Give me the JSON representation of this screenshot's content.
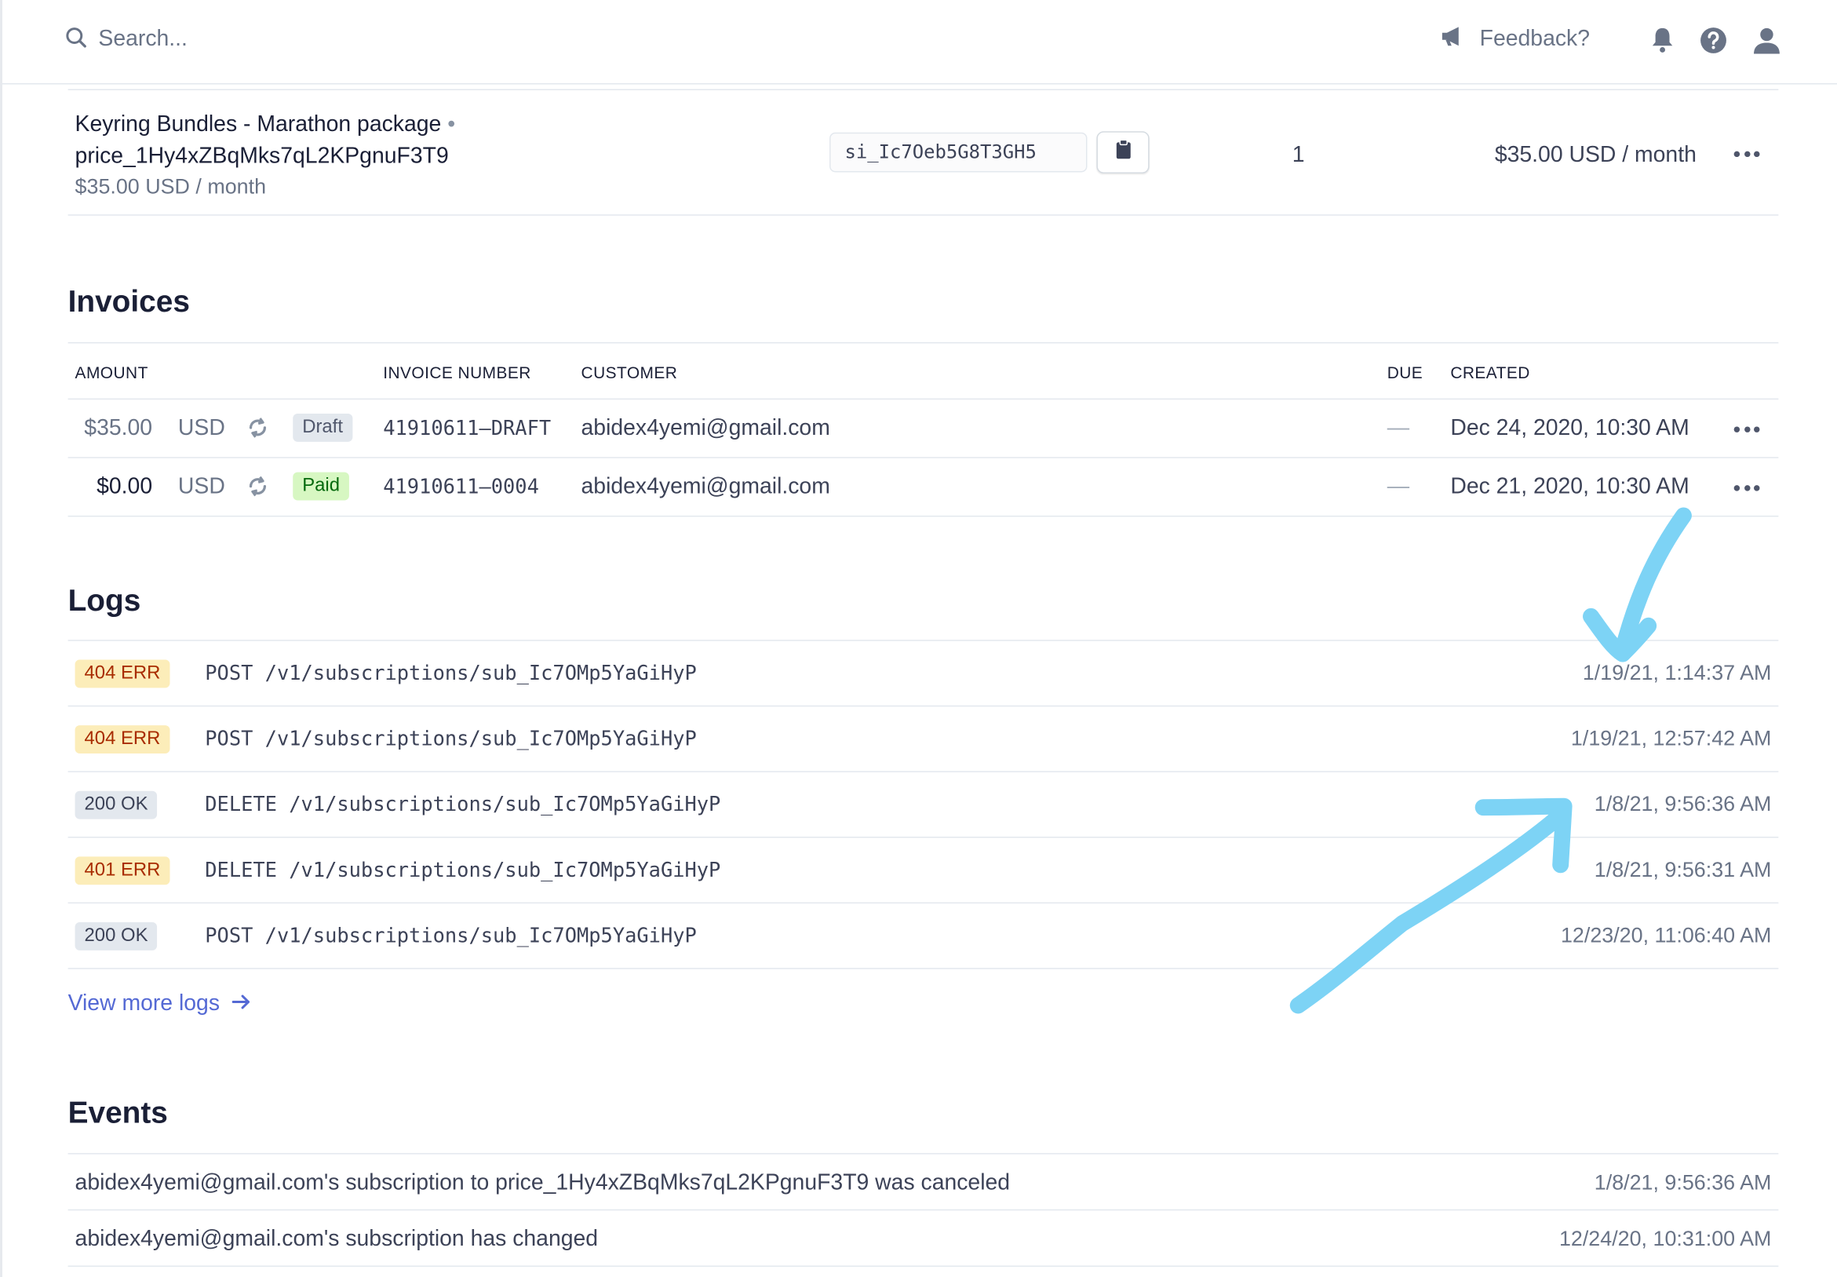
{
  "topbar": {
    "search_placeholder": "Search...",
    "feedback_label": "Feedback?"
  },
  "subscription_item": {
    "product_name": "Keyring Bundles - Marathon package",
    "separator": "•",
    "price_id": "price_1Hy4xZBqMks7qL2KPgnuF3T9",
    "price_sub": "$35.00 USD / month",
    "item_id": "si_Ic7Oeb5G8T3GH5",
    "quantity": "1",
    "total": "$35.00 USD / month"
  },
  "invoices": {
    "title": "Invoices",
    "columns": {
      "amount": "AMOUNT",
      "invoice_number": "INVOICE NUMBER",
      "customer": "CUSTOMER",
      "due": "DUE",
      "created": "CREATED"
    },
    "rows": [
      {
        "amount": "$35.00",
        "currency": "USD",
        "status": "Draft",
        "number": "41910611–DRAFT",
        "customer": "abidex4yemi@gmail.com",
        "due": "—",
        "created": "Dec 24, 2020, 10:30 AM"
      },
      {
        "amount": "$0.00",
        "currency": "USD",
        "status": "Paid",
        "number": "41910611–0004",
        "customer": "abidex4yemi@gmail.com",
        "due": "—",
        "created": "Dec 21, 2020, 10:30 AM"
      }
    ]
  },
  "logs": {
    "title": "Logs",
    "rows": [
      {
        "status": "404 ERR",
        "path": "POST /v1/subscriptions/sub_Ic7OMp5YaGiHyP",
        "time": "1/19/21, 1:14:37 AM"
      },
      {
        "status": "404 ERR",
        "path": "POST /v1/subscriptions/sub_Ic7OMp5YaGiHyP",
        "time": "1/19/21, 12:57:42 AM"
      },
      {
        "status": "200 OK",
        "path": "DELETE /v1/subscriptions/sub_Ic7OMp5YaGiHyP",
        "time": "1/8/21, 9:56:36 AM"
      },
      {
        "status": "401 ERR",
        "path": "DELETE /v1/subscriptions/sub_Ic7OMp5YaGiHyP",
        "time": "1/8/21, 9:56:31 AM"
      },
      {
        "status": "200 OK",
        "path": "POST /v1/subscriptions/sub_Ic7OMp5YaGiHyP",
        "time": "12/23/20, 11:06:40 AM"
      }
    ],
    "view_more": "View more logs"
  },
  "events": {
    "title": "Events",
    "rows": [
      {
        "text": "abidex4yemi@gmail.com's subscription to price_1Hy4xZBqMks7qL2KPgnuF3T9 was canceled",
        "time": "1/8/21, 9:56:36 AM"
      },
      {
        "text": "abidex4yemi@gmail.com's subscription has changed",
        "time": "12/24/20, 10:31:00 AM"
      }
    ]
  },
  "colors": {
    "link": "#5469d4",
    "annotation_stroke": "#7dd3f5",
    "badge_warn_bg": "#fcedb9",
    "badge_paid_bg": "#d7f7c2"
  }
}
